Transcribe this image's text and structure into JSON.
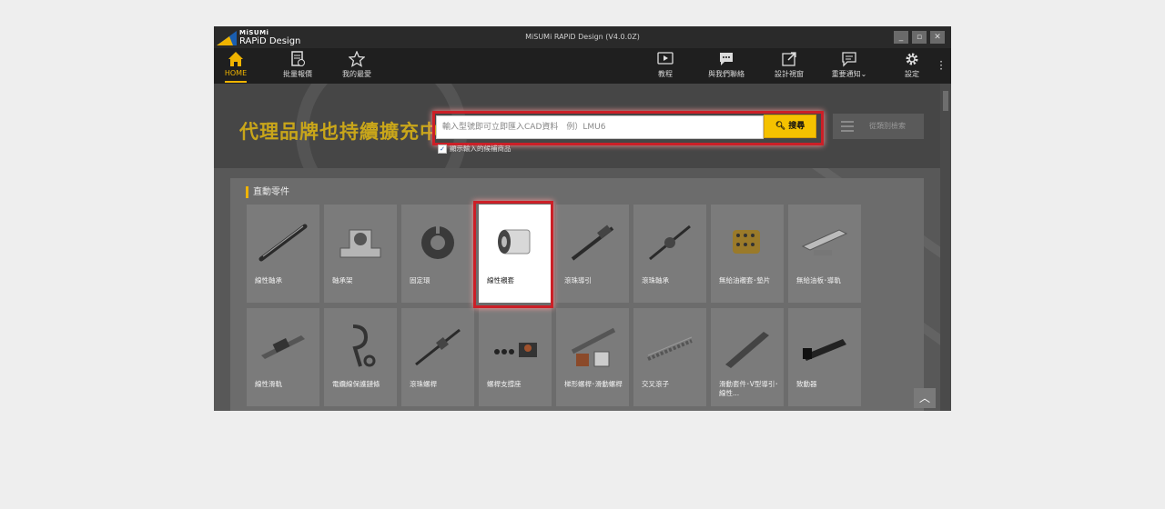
{
  "window": {
    "brand_small": "MiSUMi",
    "brand_large": "RAPiD Design",
    "title": "MiSUMi RAPiD Design (V4.0.0Z)",
    "controls": [
      "_",
      "▫",
      "✕"
    ]
  },
  "toolbar": {
    "home": "HOME",
    "batch_quote": "批量報價",
    "favorites": "我的最愛",
    "tutorial": "教程",
    "contact": "與我們聯絡",
    "design_report": "設計視窗",
    "notifications": "重要通知",
    "settings": "設定"
  },
  "hero": {
    "banner": "代理品牌也持續擴充中",
    "search_placeholder": "輸入型號即可立即匯入CAD資料　例）LMU6",
    "search_button": "搜尋",
    "show_checkbox": "顯示輸入的候補商品",
    "category_search": "從類別檢索"
  },
  "section": {
    "title": "直動零件"
  },
  "products": [
    {
      "label": "線性軸承",
      "icon": "linear-shaft-icon"
    },
    {
      "label": "軸承架",
      "icon": "shaft-support-icon"
    },
    {
      "label": "固定環",
      "icon": "collar-icon"
    },
    {
      "label": "線性襯套",
      "icon": "linear-bushing-icon",
      "selected": true
    },
    {
      "label": "滾珠導引",
      "icon": "ball-guide-icon"
    },
    {
      "label": "滾珠軸承",
      "icon": "ball-shaft-icon"
    },
    {
      "label": "無給油襯套･墊片",
      "icon": "oilless-bushing-icon"
    },
    {
      "label": "無給油板･導軌",
      "icon": "oilless-plate-icon"
    },
    {
      "label": "線性滑軌",
      "icon": "linear-guide-icon"
    },
    {
      "label": "電纜線保護鏈條",
      "icon": "cable-chain-icon"
    },
    {
      "label": "滾珠螺桿",
      "icon": "ball-screw-icon"
    },
    {
      "label": "螺桿支撐座",
      "icon": "screw-support-icon"
    },
    {
      "label": "梯形螺桿･滑動螺桿",
      "icon": "trapezoid-screw-icon"
    },
    {
      "label": "交叉滾子",
      "icon": "cross-roller-icon"
    },
    {
      "label": "滑動套件･V型導引･線性...",
      "icon": "slide-unit-icon"
    },
    {
      "label": "致動器",
      "icon": "actuator-icon"
    }
  ],
  "colors": {
    "accent": "#f0b400",
    "highlight": "#cc1f27",
    "toolbar_bg": "#1f1f1f"
  }
}
